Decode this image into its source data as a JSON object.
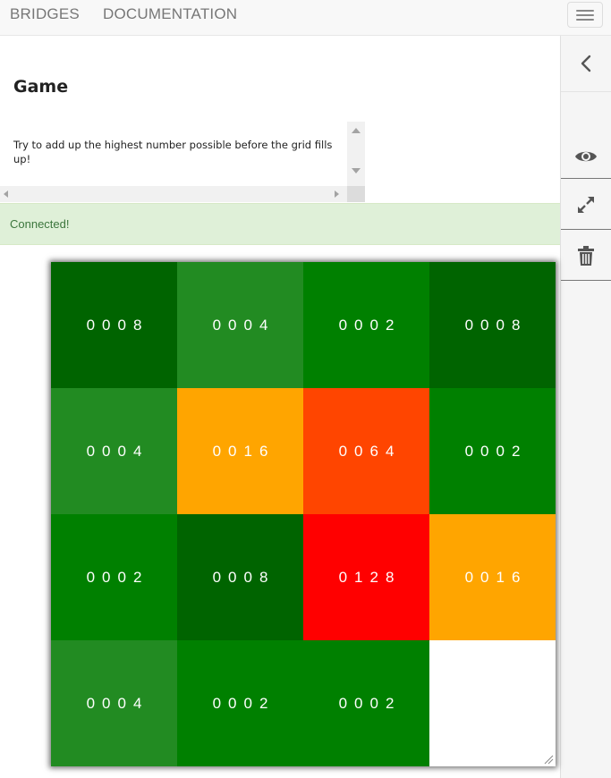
{
  "nav": {
    "links": [
      "BRIDGES",
      "DOCUMENTATION"
    ]
  },
  "page": {
    "title": "Game",
    "description": "Try to add up the highest number possible before the grid fills up!"
  },
  "status": {
    "message": "Connected!"
  },
  "sidebar": {
    "icons": [
      "chevron-left-icon",
      "eye-icon",
      "expand-icon",
      "trash-icon"
    ]
  },
  "colors": {
    "dark_green": "#006400",
    "forest_green": "#228b22",
    "green": "#008000",
    "orange": "#ffa500",
    "orange_red": "#ff4500",
    "red": "#ff0000",
    "empty": "#ffffff",
    "alert_bg": "#dff0d8",
    "alert_text": "#3c763d"
  },
  "board": {
    "rows": 4,
    "cols": 4,
    "cells": [
      {
        "label": "0008",
        "color": "#006400"
      },
      {
        "label": "0004",
        "color": "#228b22"
      },
      {
        "label": "0002",
        "color": "#008000"
      },
      {
        "label": "0008",
        "color": "#006400"
      },
      {
        "label": "0004",
        "color": "#228b22"
      },
      {
        "label": "0016",
        "color": "#ffa500"
      },
      {
        "label": "0064",
        "color": "#ff4500"
      },
      {
        "label": "0002",
        "color": "#008000"
      },
      {
        "label": "0002",
        "color": "#008000"
      },
      {
        "label": "0008",
        "color": "#006400"
      },
      {
        "label": "0128",
        "color": "#ff0000"
      },
      {
        "label": "0016",
        "color": "#ffa500"
      },
      {
        "label": "0004",
        "color": "#228b22"
      },
      {
        "label": "0002",
        "color": "#008000"
      },
      {
        "label": "0002",
        "color": "#008000"
      },
      {
        "label": "",
        "color": "#ffffff"
      }
    ]
  }
}
